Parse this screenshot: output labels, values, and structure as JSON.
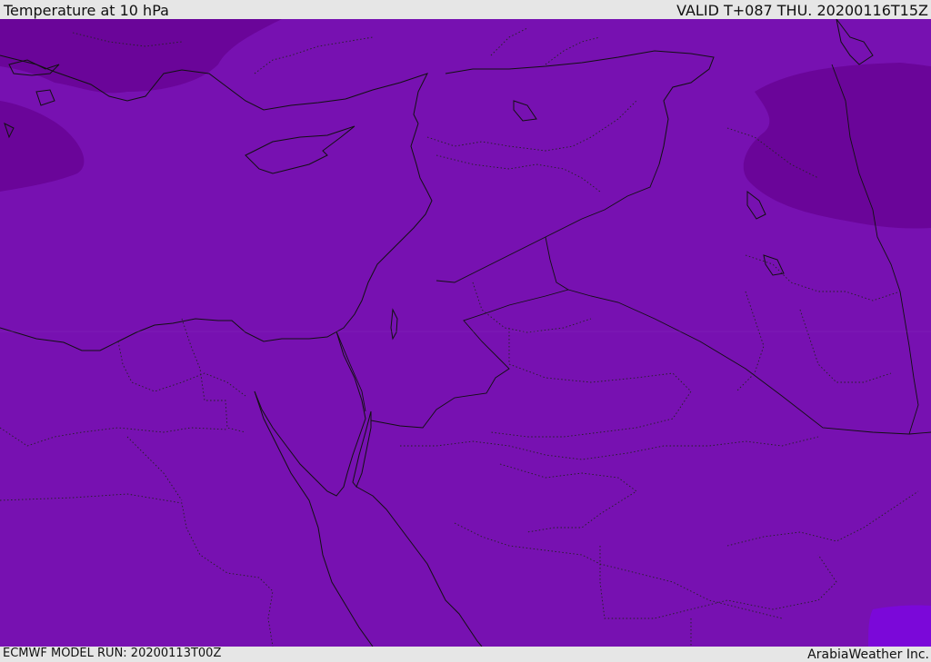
{
  "header": {
    "title": "Temperature at 10 hPa",
    "valid": "VALID T+087 THU. 20200116T15Z"
  },
  "footer": {
    "model_run": "ECMWF MODEL RUN: 20200113T00Z",
    "credit": "ArabiaWeather Inc."
  },
  "map": {
    "colors": {
      "base_fill": "#7711b1",
      "cold_patch": "#6a0599",
      "warm_patch": "#7b08d9",
      "lines": "#111111"
    }
  }
}
